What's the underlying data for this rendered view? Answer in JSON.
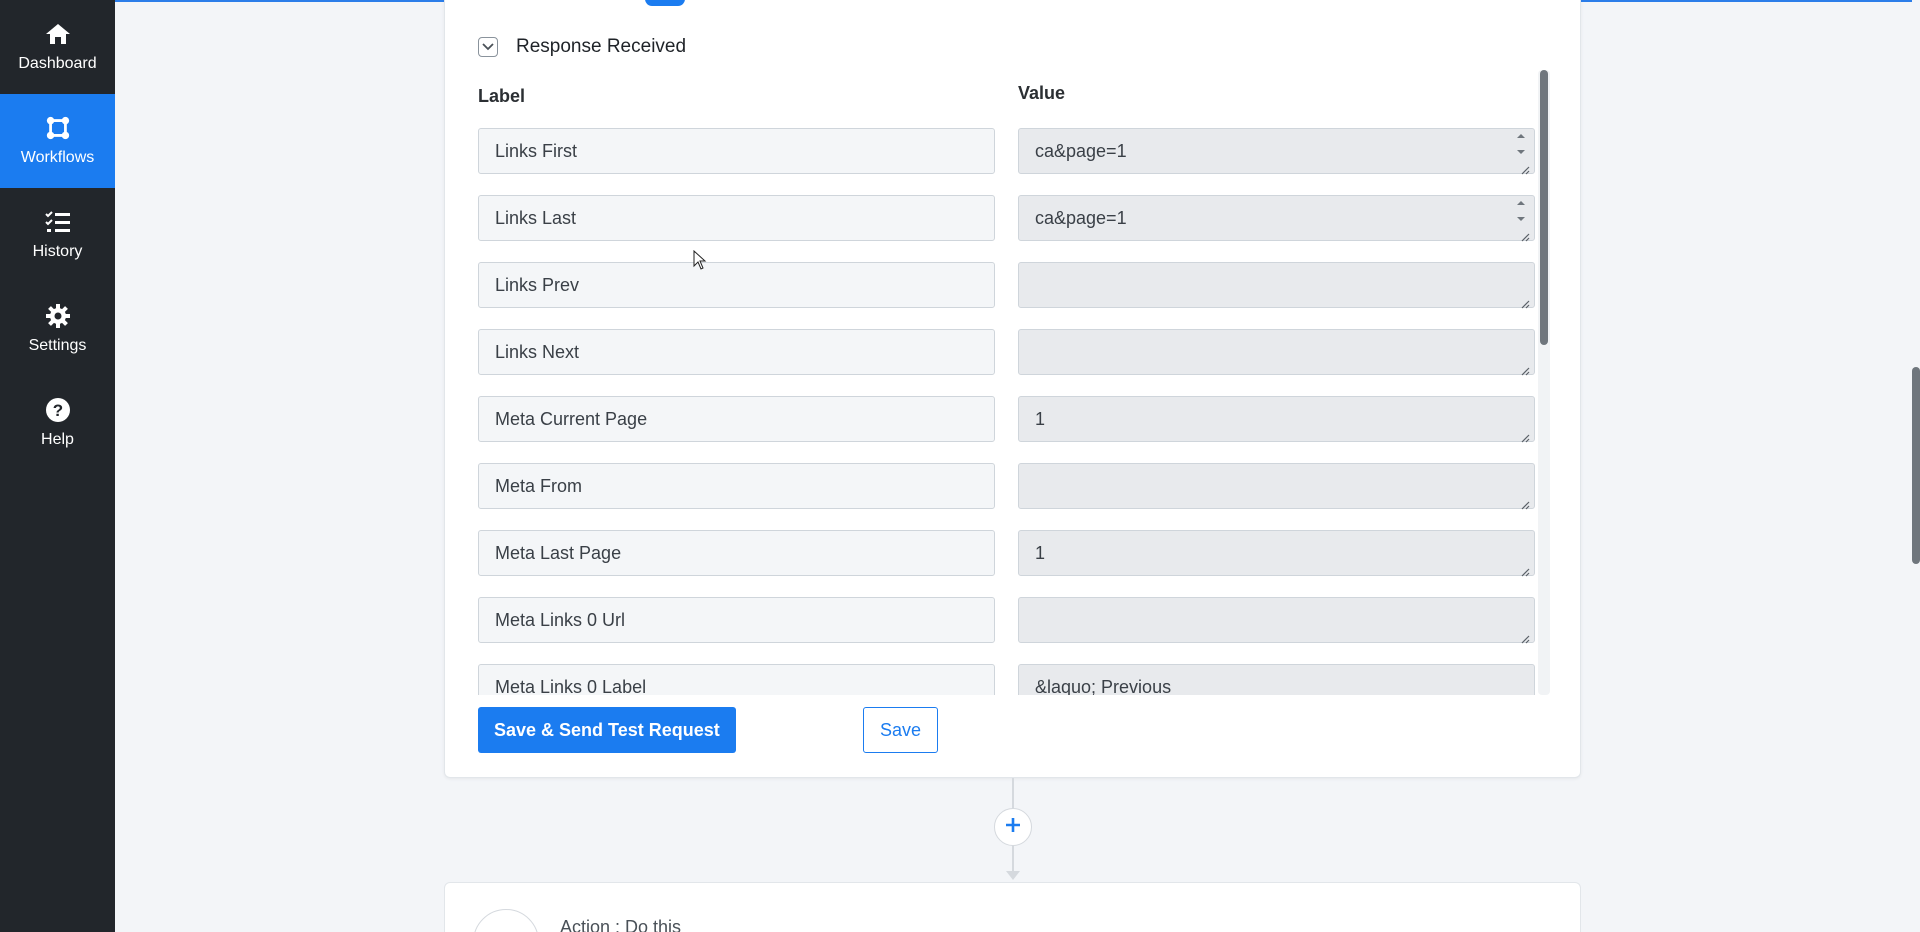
{
  "sidebar": {
    "items": [
      {
        "label": "Dashboard",
        "icon": "home-icon",
        "active": false
      },
      {
        "label": "Workflows",
        "icon": "workflow-icon",
        "active": true
      },
      {
        "label": "History",
        "icon": "history-icon",
        "active": false
      },
      {
        "label": "Settings",
        "icon": "gear-icon",
        "active": false
      },
      {
        "label": "Help",
        "icon": "help-icon",
        "active": false
      }
    ]
  },
  "section": {
    "title": "Response Received",
    "label_header": "Label",
    "value_header": "Value"
  },
  "rows": [
    {
      "label": "Links First",
      "value": "ca&page=1",
      "spinner": true
    },
    {
      "label": "Links Last",
      "value": "ca&page=1",
      "spinner": true
    },
    {
      "label": "Links Prev",
      "value": "",
      "spinner": false
    },
    {
      "label": "Links Next",
      "value": "",
      "spinner": false
    },
    {
      "label": "Meta Current Page",
      "value": "1",
      "spinner": false
    },
    {
      "label": "Meta From",
      "value": "",
      "spinner": false
    },
    {
      "label": "Meta Last Page",
      "value": "1",
      "spinner": false
    },
    {
      "label": "Meta Links 0 Url",
      "value": "",
      "spinner": false
    },
    {
      "label": "Meta Links 0 Label",
      "value": "&laquo; Previous",
      "spinner": false
    }
  ],
  "actions": {
    "save_send_label": "Save & Send Test Request",
    "save_label": "Save"
  },
  "next_step": {
    "title": "Action : Do this",
    "avatar_text": "..."
  },
  "colors": {
    "accent": "#1b7cf0",
    "sidebar_bg": "#22262b",
    "page_bg": "#f3f5f8"
  }
}
